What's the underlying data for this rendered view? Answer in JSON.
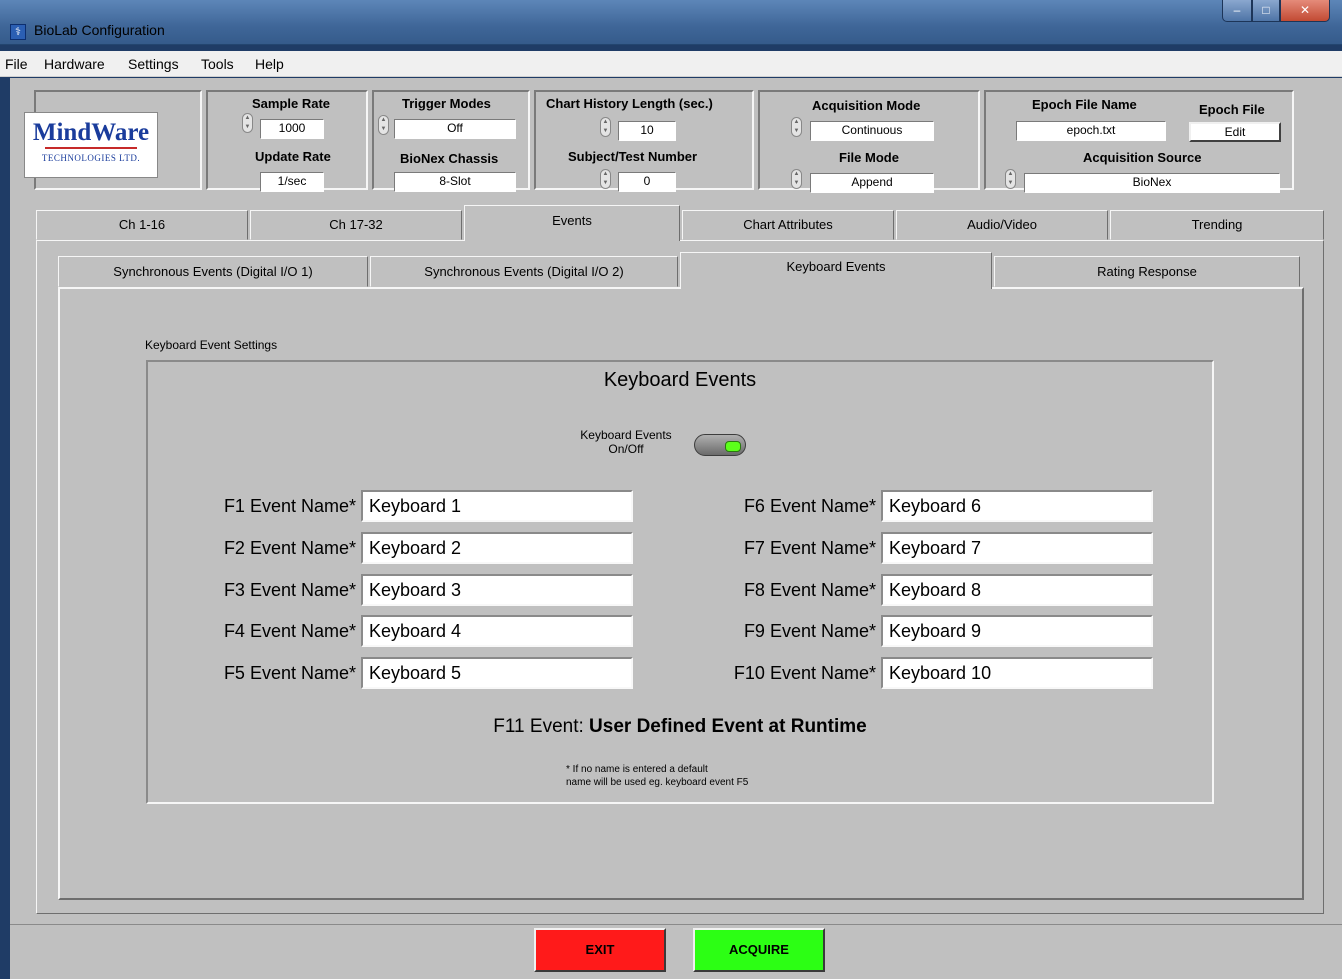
{
  "window": {
    "title": "BioLab Configuration"
  },
  "menu": [
    "File",
    "Hardware",
    "Settings",
    "Tools",
    "Help"
  ],
  "logo": {
    "main": "MindWare",
    "sub": "TECHNOLOGIES LTD."
  },
  "settings": {
    "sample_rate_label": "Sample Rate",
    "sample_rate": "1000",
    "update_rate_label": "Update Rate",
    "update_rate": "1/sec",
    "trigger_modes_label": "Trigger Modes",
    "trigger_modes": "Off",
    "bionex_chassis_label": "BioNex Chassis",
    "bionex_chassis": "8-Slot",
    "chart_history_label": "Chart History Length (sec.)",
    "chart_history": "10",
    "subject_label": "Subject/Test Number",
    "subject": "0",
    "acq_mode_label": "Acquisition Mode",
    "acq_mode": "Continuous",
    "file_mode_label": "File Mode",
    "file_mode": "Append",
    "epoch_file_name_label": "Epoch File Name",
    "epoch_file_name": "epoch.txt",
    "epoch_file_label": "Epoch File",
    "epoch_file_button": "Edit",
    "acq_source_label": "Acquisition Source",
    "acq_source": "BioNex"
  },
  "main_tabs": [
    "Ch 1-16",
    "Ch 17-32",
    "Events",
    "Chart Attributes",
    "Audio/Video",
    "Trending"
  ],
  "sub_tabs": [
    "Synchronous Events (Digital I/O 1)",
    "Synchronous Events (Digital I/O 2)",
    "Keyboard Events",
    "Rating Response"
  ],
  "keyboard": {
    "settings_label": "Keyboard Event Settings",
    "heading": "Keyboard Events",
    "toggle_label_1": "Keyboard Events",
    "toggle_label_2": "On/Off",
    "toggle_on": true,
    "events": [
      {
        "label": "F1 Event Name*",
        "value": "Keyboard 1"
      },
      {
        "label": "F2 Event Name*",
        "value": "Keyboard 2"
      },
      {
        "label": "F3 Event Name*",
        "value": "Keyboard 3"
      },
      {
        "label": "F4 Event Name*",
        "value": "Keyboard 4"
      },
      {
        "label": "F5 Event Name*",
        "value": "Keyboard 5"
      },
      {
        "label": "F6 Event Name*",
        "value": "Keyboard 6"
      },
      {
        "label": "F7 Event Name*",
        "value": "Keyboard 7"
      },
      {
        "label": "F8 Event Name*",
        "value": "Keyboard 8"
      },
      {
        "label": "F9 Event Name*",
        "value": "Keyboard 9"
      },
      {
        "label": "F10 Event Name*",
        "value": "Keyboard 10"
      }
    ],
    "f11_prefix": "F11 Event:",
    "f11_text": "User Defined Event at Runtime",
    "note_1": "* If no name is entered a default",
    "note_2": "name will be used eg. keyboard event F5"
  },
  "buttons": {
    "exit": "EXIT",
    "acquire": "ACQUIRE"
  },
  "colors": {
    "exit": "#ff1a1a",
    "acquire": "#2cff14",
    "toggle_indicator": "#5cff1a"
  }
}
